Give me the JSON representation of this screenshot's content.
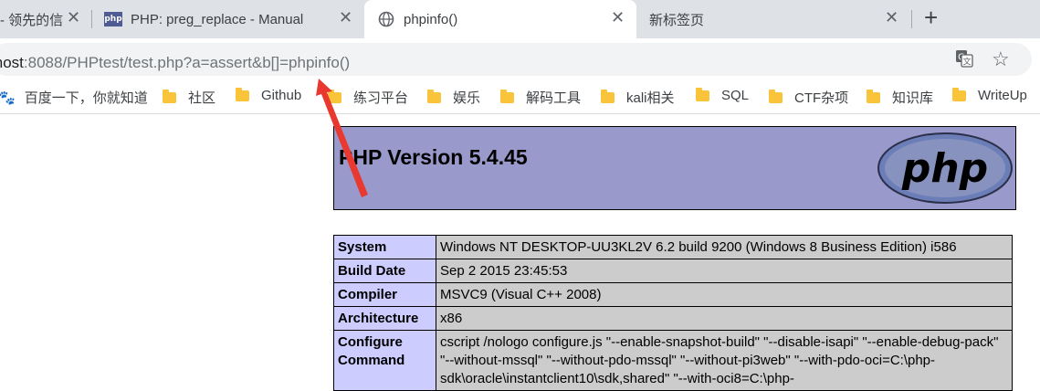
{
  "tabs": [
    {
      "title": "- 领先的信",
      "favicon": "none"
    },
    {
      "title": "PHP: preg_replace - Manual",
      "favicon": "php-icon"
    },
    {
      "title": "phpinfo()",
      "favicon": "globe-icon",
      "active": true
    },
    {
      "title": "新标签页",
      "favicon": "none"
    }
  ],
  "tab_close": "✕",
  "new_tab": "+",
  "address": {
    "host_visible": "lhost",
    "rest": ":8088/PHPtest/test.php?a=assert&b[]=phpinfo()"
  },
  "bookmarks": [
    {
      "label": "百度一下，你就知道",
      "icon": "paw-icon"
    },
    {
      "label": "社区",
      "icon": "folder-icon"
    },
    {
      "label": "Github",
      "icon": "folder-icon"
    },
    {
      "label": "练习平台",
      "icon": "folder-icon"
    },
    {
      "label": "娱乐",
      "icon": "folder-icon"
    },
    {
      "label": "解码工具",
      "icon": "folder-icon"
    },
    {
      "label": "kali相关",
      "icon": "folder-icon"
    },
    {
      "label": "SQL",
      "icon": "folder-icon"
    },
    {
      "label": "CTF杂项",
      "icon": "folder-icon"
    },
    {
      "label": "知识库",
      "icon": "folder-icon"
    },
    {
      "label": "WriteUp",
      "icon": "folder-icon"
    }
  ],
  "phpinfo": {
    "version_title": "PHP Version 5.4.45",
    "logo_text": "php",
    "rows": [
      {
        "key": "System",
        "value": "Windows NT DESKTOP-UU3KL2V 6.2 build 9200 (Windows 8 Business Edition) i586"
      },
      {
        "key": "Build Date",
        "value": "Sep 2 2015 23:45:53"
      },
      {
        "key": "Compiler",
        "value": "MSVC9 (Visual C++ 2008)"
      },
      {
        "key": "Architecture",
        "value": "x86"
      },
      {
        "key": "Configure Command",
        "value": "cscript /nologo configure.js \"--enable-snapshot-build\" \"--disable-isapi\" \"--enable-debug-pack\" \"--without-mssql\" \"--without-pdo-mssql\" \"--without-pi3web\" \"--with-pdo-oci=C:\\php-sdk\\oracle\\instantclient10\\sdk,shared\" \"--with-oci8=C:\\php-"
      }
    ]
  },
  "colors": {
    "header_bg": "#9999cc",
    "key_bg": "#ccccff",
    "value_bg": "#cccccc",
    "annotation_arrow": "#e8382f"
  }
}
